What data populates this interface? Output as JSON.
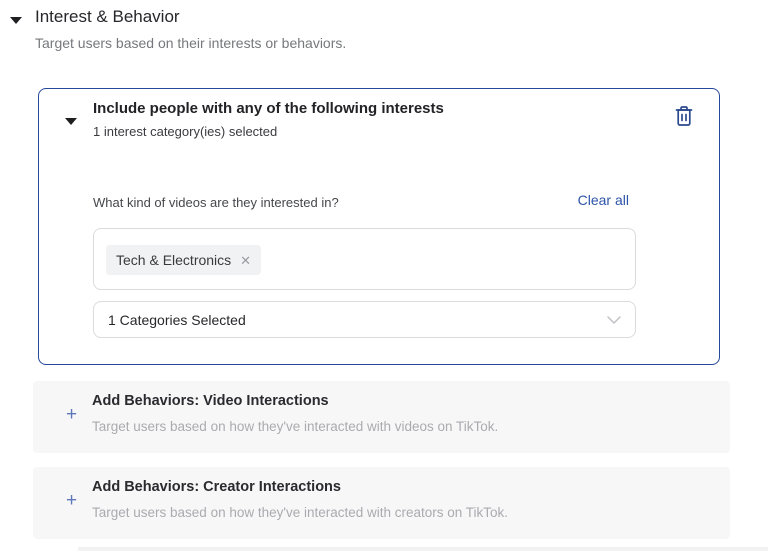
{
  "section": {
    "title": "Interest & Behavior",
    "subtitle": "Target users based on their interests or behaviors."
  },
  "interest_card": {
    "title": "Include people with any of the following interests",
    "subtitle": "1 interest category(ies) selected",
    "question_label": "What kind of videos are they interested in?",
    "clear_all_label": "Clear all",
    "tags": [
      {
        "label": "Tech & Electronics"
      }
    ],
    "dropdown_value": "1 Categories Selected"
  },
  "behavior_panels": [
    {
      "title": "Add Behaviors: Video Interactions",
      "description": "Target users based on how they've interacted with videos on TikTok."
    },
    {
      "title": "Add Behaviors: Creator Interactions",
      "description": "Target users based on how they've interacted with creators on TikTok."
    }
  ],
  "icons": {
    "plus": "+",
    "tag_remove": "✕",
    "collapse_caret": "caret-down",
    "trash": "trash-icon",
    "dropdown_chevron": "chevron-down"
  },
  "colors": {
    "card_border_blue": "#26499c",
    "link_blue": "#2d54a8",
    "trash_blue": "#2b4a8f",
    "plus_blue": "#5e77b8",
    "panel_gray": "#f7f7f8",
    "tag_bg": "#f1f2f4"
  }
}
